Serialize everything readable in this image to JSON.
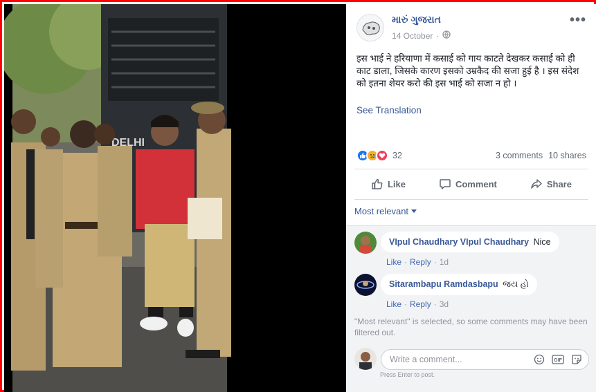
{
  "post": {
    "page_name": "મારું ગુજરાત",
    "date": "14 October",
    "text": "इस भाई ने हरियाणा में कसाई को गाय काटते देखकर कसाई को ही काट डाला, जिसके कारण इसको उम्रकैद की सजा हुई है । इस संदेश को इतना शेयर करो की इस भाई को सजा न हो ।",
    "see_translation": "See Translation",
    "more_label": "•••",
    "photo_van_text": "DELHI"
  },
  "reactions": {
    "count": "32",
    "comments": "3 comments",
    "shares": "10 shares",
    "icons": [
      "like-icon",
      "sad-icon",
      "love-icon"
    ],
    "colors": {
      "like": "#1877f2",
      "sad": "#f7b125",
      "love": "#f33e58"
    }
  },
  "actions": {
    "like": "Like",
    "comment": "Comment",
    "share": "Share"
  },
  "comments_section": {
    "filter_label": "Most relevant",
    "items": [
      {
        "author": "VIpul Chaudhary VIpul Chaudhary",
        "text": "Nice",
        "like": "Like",
        "reply": "Reply",
        "time": "1d"
      },
      {
        "author": "Sitarambapu Ramdasbapu",
        "text": "જય હો",
        "like": "Like",
        "reply": "Reply",
        "time": "3d"
      }
    ],
    "filter_note": "\"Most relevant\" is selected, so some comments may have been filtered out.",
    "composer_placeholder": "Write a comment...",
    "press_enter": "Press Enter to post."
  },
  "colors": {
    "link": "#385898",
    "frame_border": "#ff0000"
  }
}
